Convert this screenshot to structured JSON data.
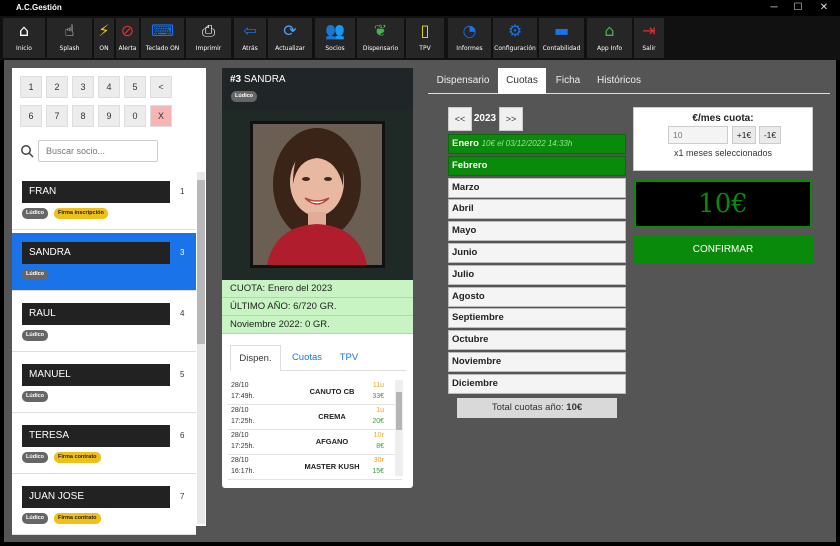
{
  "window": {
    "title": "A.C.Gestión",
    "controls": {
      "minimize": "─",
      "maximize": "☐",
      "close": "✕"
    }
  },
  "toolbar": [
    {
      "label": "Inicio",
      "icon": "home-icon",
      "glyph": "⌂",
      "color": "#ffffff"
    },
    {
      "label": "Splash",
      "icon": "hand-pointer-icon",
      "glyph": "☝",
      "color": "#ffffff"
    },
    {
      "label": "ON",
      "icon": "lightning-icon",
      "glyph": "⚡",
      "color": "#f5c518"
    },
    {
      "label": "Alerta",
      "icon": "alert-prohibited-icon",
      "glyph": "⊘",
      "color": "#e03030"
    },
    {
      "label": "Teclado ON",
      "icon": "keyboard-icon",
      "glyph": "⌨",
      "color": "#1a73e8"
    },
    {
      "label": "Imprimir",
      "icon": "printer-icon",
      "glyph": "⎙",
      "color": "#ffffff"
    },
    {
      "label": "Atrás",
      "icon": "back-arrow-icon",
      "glyph": "⇦",
      "color": "#1a73e8"
    },
    {
      "label": "Actualizar",
      "icon": "refresh-icon",
      "glyph": "⟳",
      "color": "#4aa3ff"
    },
    {
      "label": "Socios",
      "icon": "users-icon",
      "glyph": "👥",
      "color": "#4aa3ff"
    },
    {
      "label": "Dispensario",
      "icon": "leaf-icon",
      "glyph": "❦",
      "color": "#4caf50"
    },
    {
      "label": "TPV",
      "icon": "trash-bin-icon",
      "glyph": "▯",
      "color": "#f0e020"
    },
    {
      "label": "Informes",
      "icon": "chart-icon",
      "glyph": "◔",
      "color": "#1a73e8"
    },
    {
      "label": "Configuración",
      "icon": "settings-sliders-icon",
      "glyph": "⚙",
      "color": "#1a73e8"
    },
    {
      "label": "Contabilidad",
      "icon": "folder-icon",
      "glyph": "▬",
      "color": "#1a73e8"
    },
    {
      "label": "App Info",
      "icon": "house-leaf-icon",
      "glyph": "⌂",
      "color": "#4caf50"
    },
    {
      "label": "Salir",
      "icon": "exit-door-icon",
      "glyph": "⇥",
      "color": "#e03030"
    }
  ],
  "numpad": {
    "keys": [
      "1",
      "2",
      "3",
      "4",
      "5",
      "<",
      "6",
      "7",
      "8",
      "9",
      "0",
      "X"
    ]
  },
  "search": {
    "placeholder": "Buscar socio..."
  },
  "members": [
    {
      "name": "FRAN",
      "number": "1",
      "badges": [
        "Lúdico",
        "Firma inscripción"
      ]
    },
    {
      "name": "SANDRA",
      "number": "3",
      "badges": [
        "Lúdico"
      ]
    },
    {
      "name": "RAUL",
      "number": "4",
      "badges": [
        "Lúdico"
      ]
    },
    {
      "name": "MANUEL",
      "number": "5",
      "badges": [
        "Lúdico"
      ]
    },
    {
      "name": "TERESA",
      "number": "6",
      "badges": [
        "Lúdico",
        "Firma contrato"
      ]
    },
    {
      "name": "JUAN JOSE",
      "number": "7",
      "badges": [
        "Lúdico",
        "Firma contrato"
      ]
    }
  ],
  "profile": {
    "id": "#3",
    "name": "SANDRA",
    "badge": "Lúdico",
    "cuota": "CUOTA: Enero del 2023",
    "ultimo": "ÚLTIMO AÑO: 6/720 GR.",
    "noviembre": "Noviembre 2022: 0 GR.",
    "tabs": [
      "Dispen.",
      "Cuotas",
      "TPV"
    ],
    "sales": [
      {
        "date": "28/10",
        "time": "17:49h.",
        "product": "CANUTO CB",
        "qty": "11u",
        "price": "33€"
      },
      {
        "date": "28/10",
        "time": "17:25h.",
        "product": "CREMA",
        "qty": "1u",
        "price": "20€"
      },
      {
        "date": "28/10",
        "time": "17:25h.",
        "product": "AFGANO",
        "qty": "10г",
        "price": "8€"
      },
      {
        "date": "28/10",
        "time": "16:17h.",
        "product": "MASTER KUSH",
        "qty": "30г",
        "price": "15€"
      }
    ]
  },
  "tabs": [
    "Dispensario",
    "Cuotas",
    "Ficha",
    "Históricos"
  ],
  "year": {
    "prev": "<<",
    "value": "2023",
    "next": ">>"
  },
  "months": [
    {
      "name": "Enero",
      "note": "10€ el 03/12/2022 14:33h",
      "paid": true
    },
    {
      "name": "Febrero",
      "note": "",
      "paid": true
    },
    {
      "name": "Marzo",
      "note": "",
      "paid": false
    },
    {
      "name": "Abril",
      "note": "",
      "paid": false
    },
    {
      "name": "Mayo",
      "note": "",
      "paid": false
    },
    {
      "name": "Junio",
      "note": "",
      "paid": false
    },
    {
      "name": "Julio",
      "note": "",
      "paid": false
    },
    {
      "name": "Agosto",
      "note": "",
      "paid": false
    },
    {
      "name": "Septiembre",
      "note": "",
      "paid": false
    },
    {
      "name": "Octubre",
      "note": "",
      "paid": false
    },
    {
      "name": "Noviembre",
      "note": "",
      "paid": false
    },
    {
      "name": "Diciembre",
      "note": "",
      "paid": false
    }
  ],
  "fee": {
    "title": "€/mes cuota:",
    "value": "10",
    "plus": "+1€",
    "minus": "-1€",
    "months_selected": "x1 meses seleccionados"
  },
  "total_display": "10€",
  "confirm_label": "CONFIRMAR",
  "year_total": {
    "label": "Total cuotas año:",
    "value": "10€"
  },
  "colors": {
    "accent": "#1a73e8",
    "paid": "#0a8a0a",
    "badge_gray": "#666666",
    "badge_yellow": "#f0c01a"
  }
}
